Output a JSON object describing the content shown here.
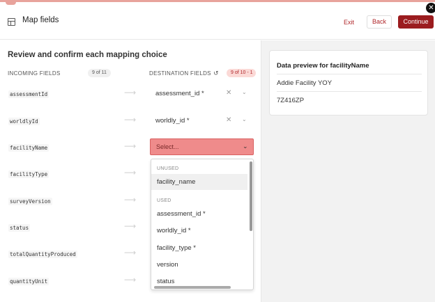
{
  "header": {
    "title": "Map fields",
    "exit_label": "Exit",
    "back_label": "Back",
    "continue_label": "Continue",
    "close_glyph": "✕"
  },
  "main": {
    "section_title": "Review and confirm each mapping choice",
    "incoming_header": "INCOMING FIELDS",
    "incoming_count": "9 of 11",
    "destination_header": "DESTINATION FIELDS",
    "destination_count": "9 of 10 - 1",
    "rows": [
      {
        "incoming": "assessmentId",
        "destination": "assessment_id *"
      },
      {
        "incoming": "worldlyId",
        "destination": "worldly_id *"
      },
      {
        "incoming": "facilityName",
        "destination": ""
      },
      {
        "incoming": "facilityType",
        "destination": ""
      },
      {
        "incoming": "surveyVersion",
        "destination": ""
      },
      {
        "incoming": "status",
        "destination": ""
      },
      {
        "incoming": "totalQuantityProduced",
        "destination": ""
      },
      {
        "incoming": "quantityUnit",
        "destination": ""
      }
    ],
    "select_placeholder": "Select...",
    "dropdown": {
      "unused_label": "UNUSED",
      "used_label": "USED",
      "unused_items": [
        "facility_name"
      ],
      "used_items": [
        "assessment_id *",
        "worldly_id *",
        "facility_type *",
        "version",
        "status"
      ]
    }
  },
  "preview": {
    "title": "Data preview for facilityName",
    "values": [
      "Addie Facility YOY",
      "7Z416ZP"
    ]
  },
  "colors": {
    "accent": "#9b1c1f",
    "error_fill": "#ef8b8b"
  }
}
